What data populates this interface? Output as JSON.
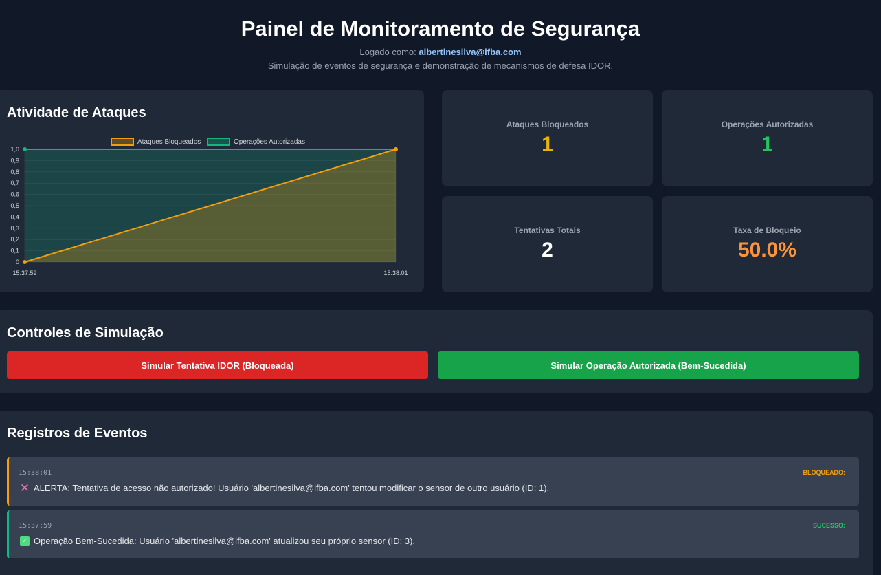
{
  "header": {
    "title": "Painel de Monitoramento de Segurança",
    "logged_prefix": "Logado como: ",
    "user_email": "albertinesilva@ifba.com",
    "subtitle": "Simulação de eventos de segurança e demonstração de mecanismos de defesa IDOR."
  },
  "chart_section": {
    "title": "Atividade de Ataques"
  },
  "chart_data": {
    "type": "area",
    "x": [
      "15:37:59",
      "15:38:01"
    ],
    "series": [
      {
        "name": "Ataques Bloqueados",
        "values": [
          0,
          1
        ],
        "color": "#f59e0b"
      },
      {
        "name": "Operações Autorizadas",
        "values": [
          1,
          1
        ],
        "color": "#10b981"
      }
    ],
    "yticks": [
      "0",
      "0,1",
      "0,2",
      "0,3",
      "0,4",
      "0,5",
      "0,6",
      "0,7",
      "0,8",
      "0,9",
      "1,0"
    ],
    "ylim": [
      0,
      1
    ],
    "grid": true,
    "legend": "top"
  },
  "stats": [
    {
      "label": "Ataques Bloqueados",
      "value": "1",
      "color": "#eab308"
    },
    {
      "label": "Operações Autorizadas",
      "value": "1",
      "color": "#22c55e"
    },
    {
      "label": "Tentativas Totais",
      "value": "2",
      "color": "#ffffff"
    },
    {
      "label": "Taxa de Bloqueio",
      "value": "50.0%",
      "color": "#fb923c"
    }
  ],
  "controls": {
    "title": "Controles de Simulação",
    "idor_button": "Simular Tentativa IDOR (Bloqueada)",
    "auth_button": "Simular Operação Autorizada (Bem-Sucedida)"
  },
  "logs": {
    "title": "Registros de Eventos",
    "entries": [
      {
        "time": "15:38:01",
        "status": "BLOQUEADO:",
        "icon": "x-icon",
        "message": "ALERTA: Tentativa de acesso não autorizado! Usuário 'albertinesilva@ifba.com' tentou modificar o sensor de outro usuário (ID: 1)."
      },
      {
        "time": "15:37:59",
        "status": "SUCESSO:",
        "icon": "check-icon",
        "message": "Operação Bem-Sucedida: Usuário 'albertinesilva@ifba.com' atualizou seu próprio sensor (ID: 3)."
      }
    ]
  }
}
